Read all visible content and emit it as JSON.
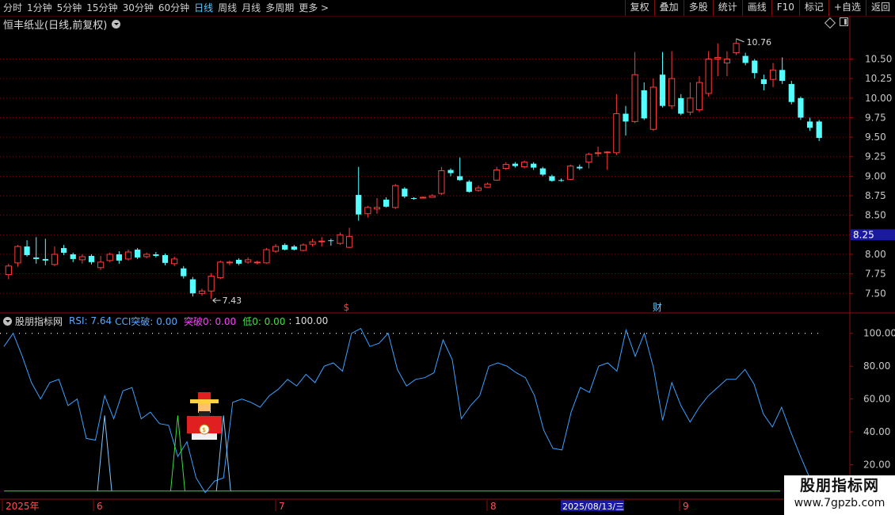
{
  "toolbar": {
    "periods": [
      "分时",
      "1分钟",
      "5分钟",
      "15分钟",
      "30分钟",
      "60分钟",
      "日线",
      "周线",
      "月线",
      "多周期",
      "更多"
    ],
    "active_period": "日线",
    "more_chevron": ">",
    "right_buttons": [
      "复权",
      "叠加",
      "多股",
      "统计",
      "画线",
      "F10",
      "标记",
      "+自选",
      "返回"
    ]
  },
  "stock_title": "恒丰纸业(日线,前复权)",
  "price_axis": {
    "labels": [
      "10.50",
      "10.25",
      "10.00",
      "9.75",
      "9.50",
      "9.25",
      "9.00",
      "8.75",
      "8.50",
      "8.25",
      "8.00",
      "7.75",
      "7.50"
    ],
    "current_price": "8.25",
    "high_marker": "10.76",
    "low_marker": "7.43"
  },
  "event_markers": [
    "$",
    "财"
  ],
  "indicator": {
    "name": "股朋指标网",
    "rsi": "RSI: 7.64",
    "cci": "CCI突破: 0.00",
    "break0": "突破0: 0.00",
    "low0": "低0: 0.00",
    "level": ": 100.00",
    "axis_labels": [
      "100.00",
      "80.00",
      "60.00",
      "40.00",
      "20.00"
    ]
  },
  "date_axis": {
    "labels": [
      "2025年",
      "6",
      "7",
      "8",
      "9"
    ],
    "cursor_date": "2025/08/13/三"
  },
  "watermark": {
    "line1": "股朋指标网",
    "line2": "www.7gpzb.com"
  },
  "colors": {
    "up": "#ff3c3c",
    "down": "#54ffff",
    "rsi_line": "#3ca0ff",
    "grid": "#8a1010",
    "baseline": "#3cdc3c",
    "cursor_bg": "#1a1aa0",
    "price_tag_bg": "#1a1aa0"
  },
  "chart_data": {
    "type": "candlestick",
    "y_min": 7.3,
    "y_max": 10.85,
    "candles": [
      [
        7.74,
        7.85,
        7.68,
        7.88
      ],
      [
        7.89,
        8.1,
        7.84,
        8.12
      ],
      [
        8.1,
        7.99,
        7.97,
        8.18
      ],
      [
        7.96,
        7.94,
        7.88,
        8.22
      ],
      [
        7.94,
        7.92,
        7.86,
        8.2
      ],
      [
        7.87,
        8.0,
        7.85,
        8.1
      ],
      [
        8.08,
        8.02,
        7.99,
        8.12
      ],
      [
        8.0,
        7.94,
        7.9,
        8.02
      ],
      [
        7.93,
        7.97,
        7.88,
        8.0
      ],
      [
        7.98,
        7.9,
        7.87,
        8.0
      ],
      [
        7.83,
        7.9,
        7.8,
        7.98
      ],
      [
        7.92,
        8.0,
        7.9,
        8.02
      ],
      [
        8.0,
        7.92,
        7.88,
        8.04
      ],
      [
        7.94,
        8.03,
        7.92,
        8.06
      ],
      [
        8.06,
        7.96,
        7.94,
        8.08
      ],
      [
        7.97,
        8.0,
        7.95,
        8.02
      ],
      [
        8.0,
        7.98,
        7.96,
        8.03
      ],
      [
        7.99,
        7.89,
        7.86,
        8.01
      ],
      [
        7.88,
        7.94,
        7.85,
        7.97
      ],
      [
        7.82,
        7.72,
        7.69,
        7.85
      ],
      [
        7.68,
        7.5,
        7.46,
        7.71
      ],
      [
        7.5,
        7.53,
        7.47,
        7.56
      ],
      [
        7.53,
        7.72,
        7.43,
        7.76
      ],
      [
        7.7,
        7.9,
        7.68,
        7.92
      ],
      [
        7.89,
        7.9,
        7.86,
        7.92
      ],
      [
        7.93,
        7.88,
        7.86,
        7.95
      ],
      [
        7.9,
        7.93,
        7.88,
        7.96
      ],
      [
        7.89,
        7.9,
        7.87,
        7.92
      ],
      [
        7.89,
        8.06,
        7.88,
        8.08
      ],
      [
        8.04,
        8.1,
        8.02,
        8.13
      ],
      [
        8.12,
        8.06,
        8.05,
        8.14
      ],
      [
        8.1,
        8.06,
        8.05,
        8.12
      ],
      [
        8.05,
        8.12,
        8.04,
        8.14
      ],
      [
        8.13,
        8.16,
        8.1,
        8.2
      ],
      [
        8.16,
        8.17,
        8.1,
        8.22
      ],
      [
        8.18,
        8.17,
        8.11,
        8.2
      ],
      [
        8.14,
        8.25,
        8.12,
        8.28
      ],
      [
        8.09,
        8.23,
        8.08,
        8.34
      ],
      [
        8.76,
        8.51,
        8.43,
        9.12
      ],
      [
        8.52,
        8.6,
        8.47,
        8.62
      ],
      [
        8.58,
        8.6,
        8.52,
        8.72
      ],
      [
        8.7,
        8.61,
        8.6,
        8.73
      ],
      [
        8.6,
        8.88,
        8.58,
        8.9
      ],
      [
        8.84,
        8.74,
        8.72,
        8.86
      ],
      [
        8.72,
        8.71,
        8.7,
        8.73
      ],
      [
        8.72,
        8.73,
        8.72,
        8.74
      ],
      [
        8.73,
        8.75,
        8.73,
        8.77
      ],
      [
        8.78,
        9.07,
        8.76,
        9.12
      ],
      [
        9.08,
        9.04,
        9.0,
        9.1
      ],
      [
        9.0,
        8.95,
        8.94,
        9.24
      ],
      [
        8.93,
        8.8,
        8.79,
        8.95
      ],
      [
        8.82,
        8.85,
        8.8,
        8.88
      ],
      [
        8.86,
        8.9,
        8.86,
        8.92
      ],
      [
        8.95,
        9.08,
        8.94,
        9.12
      ],
      [
        9.1,
        9.15,
        9.08,
        9.18
      ],
      [
        9.16,
        9.13,
        9.11,
        9.18
      ],
      [
        9.12,
        9.18,
        9.1,
        9.2
      ],
      [
        9.16,
        9.11,
        9.08,
        9.18
      ],
      [
        9.1,
        9.02,
        9.0,
        9.12
      ],
      [
        9.0,
        8.94,
        8.93,
        9.02
      ],
      [
        8.95,
        8.94,
        8.93,
        8.97
      ],
      [
        8.96,
        9.13,
        8.95,
        9.15
      ],
      [
        9.12,
        9.1,
        9.08,
        9.15
      ],
      [
        9.18,
        9.28,
        9.1,
        9.3
      ],
      [
        9.3,
        9.3,
        9.25,
        9.38
      ],
      [
        9.3,
        9.31,
        9.08,
        9.32
      ],
      [
        9.3,
        9.8,
        9.27,
        10.05
      ],
      [
        9.8,
        9.7,
        9.52,
        9.9
      ],
      [
        9.7,
        10.3,
        9.68,
        10.59
      ],
      [
        10.1,
        9.74,
        9.72,
        10.2
      ],
      [
        9.6,
        10.14,
        9.58,
        10.25
      ],
      [
        10.3,
        9.9,
        9.88,
        10.59
      ],
      [
        9.9,
        10.25,
        9.86,
        10.6
      ],
      [
        10.0,
        9.8,
        9.78,
        10.05
      ],
      [
        9.82,
        10.0,
        9.78,
        10.2
      ],
      [
        9.85,
        10.2,
        9.82,
        10.28
      ],
      [
        10.06,
        10.5,
        10.02,
        10.6
      ],
      [
        10.5,
        10.52,
        10.28,
        10.7
      ],
      [
        10.45,
        10.5,
        10.28,
        10.6
      ],
      [
        10.58,
        10.7,
        10.55,
        10.76
      ],
      [
        10.54,
        10.45,
        10.42,
        10.58
      ],
      [
        10.48,
        10.32,
        10.25,
        10.5
      ],
      [
        10.24,
        10.18,
        10.1,
        10.3
      ],
      [
        10.24,
        10.36,
        10.14,
        10.45
      ],
      [
        10.36,
        10.22,
        10.18,
        10.52
      ],
      [
        10.18,
        9.95,
        9.92,
        10.22
      ],
      [
        10.0,
        9.75,
        9.72,
        10.02
      ],
      [
        9.7,
        9.62,
        9.58,
        9.75
      ],
      [
        9.7,
        9.49,
        9.45,
        9.72
      ]
    ],
    "rsi_series": [
      92,
      100,
      86,
      70,
      60,
      70,
      72,
      56,
      60,
      36,
      35,
      62,
      48,
      65,
      67,
      48,
      52,
      45,
      44,
      25,
      34,
      12,
      3,
      10,
      12,
      58,
      60,
      58,
      55,
      62,
      66,
      72,
      68,
      75,
      70,
      80,
      82,
      77,
      100,
      103,
      92,
      94,
      100,
      78,
      68,
      72,
      73,
      76,
      96,
      84,
      48,
      56,
      62,
      80,
      82,
      80,
      76,
      73,
      62,
      41,
      30,
      29,
      52,
      67,
      64,
      80,
      82,
      77,
      102,
      86,
      100,
      79,
      47,
      70,
      56,
      46,
      55,
      62,
      67,
      72,
      72,
      78,
      69,
      51,
      43,
      55,
      40,
      26,
      13,
      7
    ],
    "rsi_ylim": [
      0,
      110
    ],
    "signal_baseline": 4,
    "signal_spikes": [
      [
        11,
        50
      ],
      [
        19,
        50
      ],
      [
        24,
        50
      ]
    ]
  }
}
